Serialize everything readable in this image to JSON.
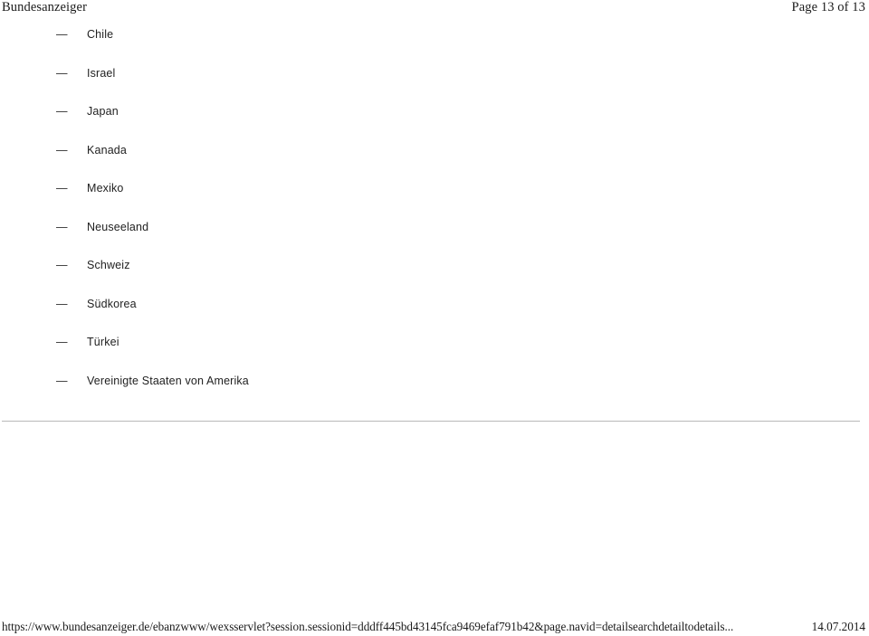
{
  "header": {
    "title": "Bundesanzeiger",
    "page_info": "Page 13 of 13"
  },
  "main": {
    "list_marker": "—",
    "countries": [
      {
        "label": "Chile"
      },
      {
        "label": "Israel"
      },
      {
        "label": "Japan"
      },
      {
        "label": "Kanada"
      },
      {
        "label": "Mexiko"
      },
      {
        "label": "Neuseeland"
      },
      {
        "label": "Schweiz"
      },
      {
        "label": "Südkorea"
      },
      {
        "label": "Türkei"
      },
      {
        "label": "Vereinigte Staaten von Amerika"
      }
    ]
  },
  "footer": {
    "url": "https://www.bundesanzeiger.de/ebanzwww/wexsservlet?session.sessionid=dddff445bd43145fca9469efaf791b42&page.navid=detailsearchdetailtodetails...",
    "date": "14.07.2014"
  },
  "colors": {
    "text": "#1a1a1a",
    "divider": "#b9b9b9",
    "background": "#ffffff"
  }
}
